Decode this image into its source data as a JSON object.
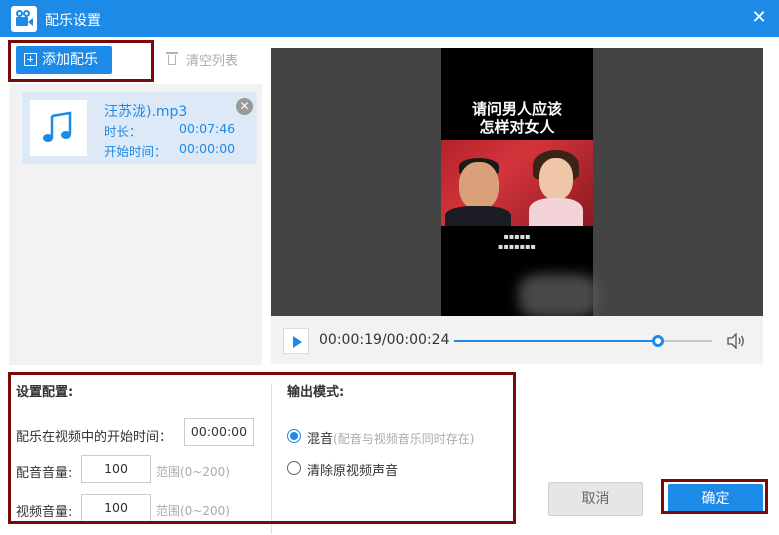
{
  "window": {
    "title": "配乐设置",
    "close_symbol": "✕"
  },
  "toolbar": {
    "add_label": "添加配乐",
    "clear_label": "清空列表"
  },
  "music_list": [
    {
      "name": "汪苏泷).mp3",
      "duration_label": "时长：",
      "duration": "00:07:46",
      "start_label": "开始时间：",
      "start": "00:00:00"
    }
  ],
  "video": {
    "caption_line1": "请问男人应该",
    "caption_line2": "怎样对女人",
    "current_time": "00:00:19",
    "total_time": "00:00:24",
    "time_display": "00:00:19/00:00:24",
    "progress": 0.79
  },
  "settings": {
    "title": "设置配置:",
    "start_time_label": "配乐在视频中的开始时间：",
    "start_time_value": "00:00:00",
    "music_volume_label": "配音音量:",
    "music_volume_value": "100",
    "music_volume_range": "范围(0~200)",
    "video_volume_label": "视频音量:",
    "video_volume_value": "100",
    "video_volume_range": "范围(0~200)"
  },
  "output": {
    "title": "输出模式:",
    "options": [
      {
        "label": "混音",
        "note": "(配音与视频音乐同时存在)",
        "checked": true
      },
      {
        "label": "清除原视频声音",
        "note": "",
        "checked": false
      }
    ]
  },
  "actions": {
    "cancel_label": "取消",
    "ok_label": "确定"
  },
  "colors": {
    "accent": "#1e8ae8",
    "highlight_box": "#7a0a0a"
  }
}
